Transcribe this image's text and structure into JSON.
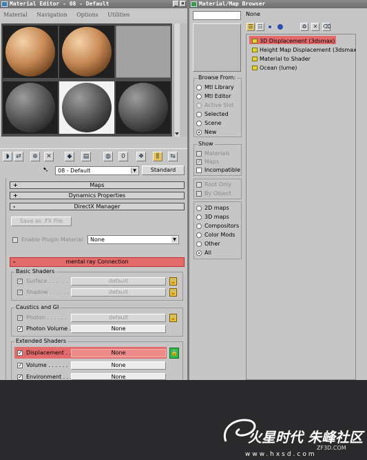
{
  "material_editor": {
    "title": "Material Editor - 08 - Default",
    "menu": [
      "Material",
      "Navigation",
      "Options",
      "Utilities"
    ],
    "current_material": "08 - Default",
    "type_button": "Standard",
    "rollouts": {
      "maps": "Maps",
      "dynamics": "Dynamics Properties",
      "directx": "DirectX Manager",
      "mental_ray": "mental ray Connection"
    },
    "directx": {
      "save_fx": "Save as .FX File",
      "enable_plugin": "Enable Plugin Material",
      "plugin_value": "None"
    },
    "basic_shaders": {
      "title": "Basic Shaders",
      "surface_label": "Surface . . . . . .",
      "surface_value": "default",
      "shadow_label": "Shadow . . . . . .",
      "shadow_value": "default"
    },
    "caustics": {
      "title": "Caustics and GI",
      "photon_label": "Photon . . . . . .",
      "photon_value": "default",
      "photon_volume_label": "Photon Volume .",
      "photon_volume_value": "None"
    },
    "extended": {
      "title": "Extended Shaders",
      "displacement_label": "Displacement . .",
      "displacement_value": "None",
      "volume_label": "Volume . . . . . .",
      "volume_value": "None",
      "environment_label": "Environment . . .",
      "environment_value": "None"
    }
  },
  "browser": {
    "title": "Material/Map Browser",
    "name_field": "",
    "selection_label": "None",
    "browse_from": {
      "title": "Browse From:",
      "options": [
        "Mtl Library",
        "Mtl Editor",
        "Active Slot",
        "Selected",
        "Scene",
        "New"
      ],
      "selected": "New"
    },
    "show": {
      "title": "Show",
      "materials": "Materials",
      "maps": "Maps",
      "incompatible": "Incompatible",
      "root_only": "Root Only",
      "by_object": "By Object"
    },
    "filters": {
      "options": [
        "2D maps",
        "3D maps",
        "Compositors",
        "Color Mods",
        "Other",
        "All"
      ],
      "selected": "All"
    },
    "items": [
      "3D Displacement (3dsmax)",
      "Height Map Displacement (3dsmax)",
      "Material to Shader",
      "Ocean (lume)"
    ]
  },
  "watermark": {
    "brand": "火星时代 朱峰社区",
    "url1": "ZF3D.COM",
    "url2": "www.hxsd.com"
  },
  "colors": {
    "highlight": "#e46b6b",
    "lock_green": "#36b84a",
    "map_icon": "#e0d23a"
  }
}
